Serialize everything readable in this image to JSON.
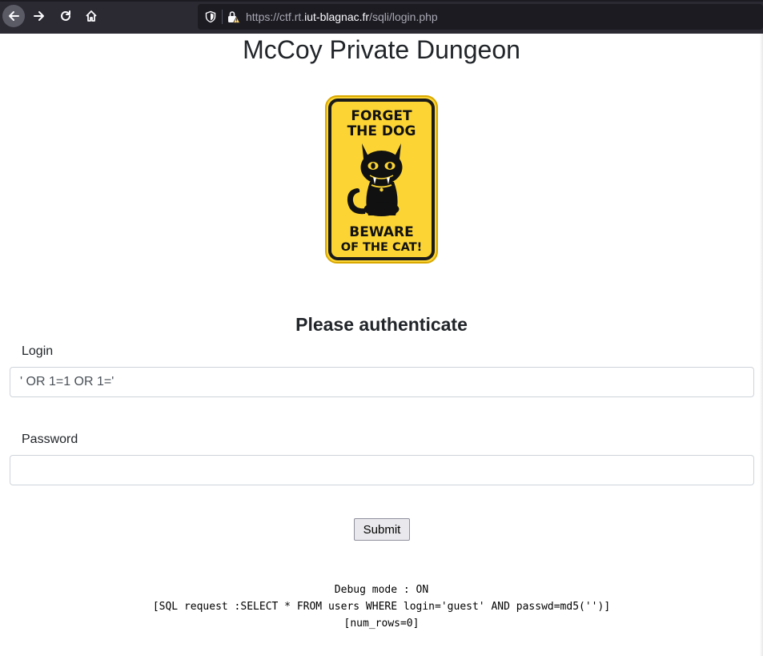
{
  "browser": {
    "url_prefix": "https://ctf.rt.",
    "url_host": "iut-blagnac.fr",
    "url_path": "/sqli/login.php",
    "icons": [
      "back-arrow-icon",
      "forward-arrow-icon",
      "reload-icon",
      "home-icon",
      "shield-icon",
      "insecure-lock-icon"
    ]
  },
  "page": {
    "title": "McCoy Private Dungeon",
    "sign": {
      "line1": "FORGET",
      "line2": "THE DOG",
      "line3": "BEWARE",
      "line4": "OF THE CAT!",
      "colors": {
        "background": "#fcd535",
        "border": "#1a1a1a",
        "ink": "#111111"
      }
    },
    "auth_heading": "Please authenticate",
    "login": {
      "label": "Login",
      "value": "' OR 1=1 OR 1='"
    },
    "password": {
      "label": "Password",
      "value": ""
    },
    "submit_label": "Submit",
    "debug": {
      "line1": "Debug mode : ON",
      "line2": "[SQL request :SELECT * FROM users WHERE login='guest' AND passwd=md5('')]",
      "line3": "[num_rows=0]"
    }
  }
}
